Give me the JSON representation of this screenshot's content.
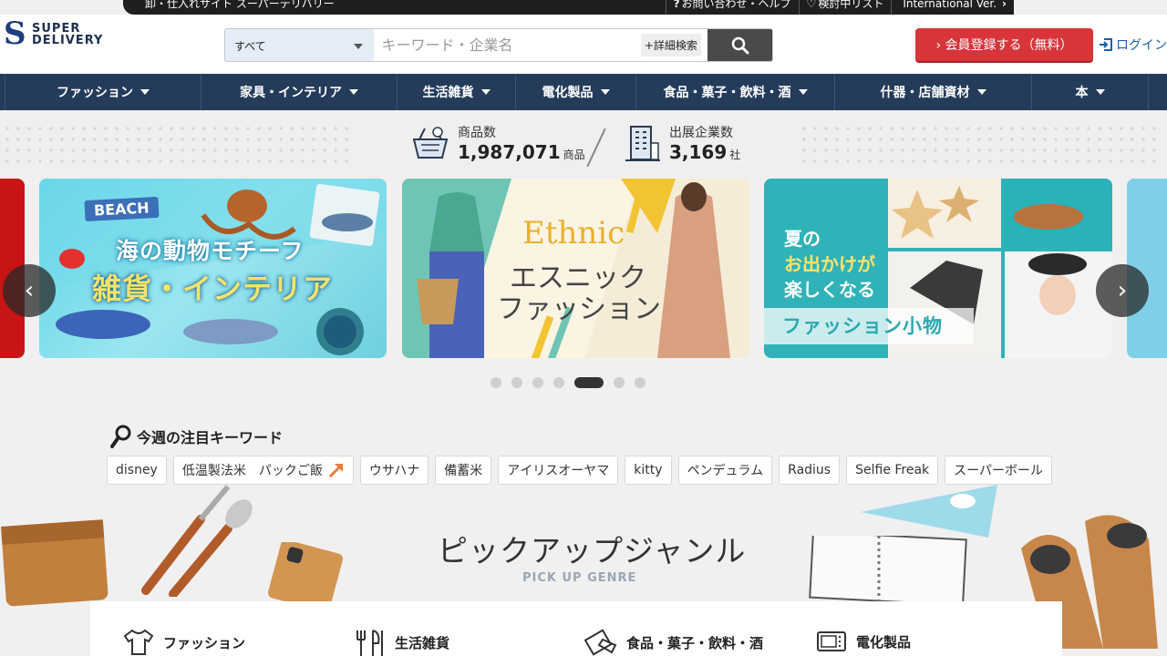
{
  "topstrip": {
    "tagline": "卸・仕入れサイト スーパーデリバリー",
    "links": [
      {
        "icon": "question-icon",
        "label": "お問い合わせ・ヘルプ"
      },
      {
        "icon": "heart-icon",
        "label": "検討中リスト"
      },
      {
        "icon": "chevron-right-icon",
        "label": "International Ver."
      }
    ]
  },
  "header": {
    "logo_line1": "SUPER",
    "logo_line2": "DELIVERY",
    "search_category": "すべて",
    "search_placeholder": "キーワード・企業名",
    "advanced_search": "+詳細検索",
    "register_label": "› 会員登録する（無料）",
    "login_label": "ログイン"
  },
  "nav": [
    "ファッション",
    "家具・インテリア",
    "生活雑貨",
    "電化製品",
    "食品・菓子・飲料・酒",
    "什器・店舗資材",
    "本"
  ],
  "stats": {
    "products_label": "商品数",
    "products_value": "1,987,071",
    "products_unit": "商品",
    "companies_label": "出展企業数",
    "companies_value": "3,169",
    "companies_unit": "社"
  },
  "carousel": {
    "slides": [
      {
        "badge": "BEACH",
        "line1": "海の動物モチーフ",
        "line2": "雑貨・インテリア"
      },
      {
        "en": "Ethnic",
        "line1": "エスニック",
        "line2": "ファッション"
      },
      {
        "line1": "夏の",
        "line2": "お出かけが",
        "line3": "楽しくなる",
        "line4": "ファッション小物"
      }
    ],
    "pages": 7,
    "active_page": 5
  },
  "keywords": {
    "title": "今週の注目キーワード",
    "items": [
      "disney",
      "低温製法米　パックご飯",
      "ウサハナ",
      "備蓄米",
      "アイリスオーヤマ",
      "kitty",
      "ペンデュラム",
      "Radius",
      "Selfie Freak",
      "スーパーボール"
    ]
  },
  "pickup": {
    "title": "ピックアップジャンル",
    "subtitle": "PICK UP GENRE",
    "genres": [
      {
        "icon": "shirt-icon",
        "label": "ファッション"
      },
      {
        "icon": "cutlery-icon",
        "label": "生活雑貨"
      },
      {
        "icon": "snack-icon",
        "label": "食品・菓子・飲料・酒"
      },
      {
        "icon": "microwave-icon",
        "label": "電化製品"
      }
    ]
  }
}
